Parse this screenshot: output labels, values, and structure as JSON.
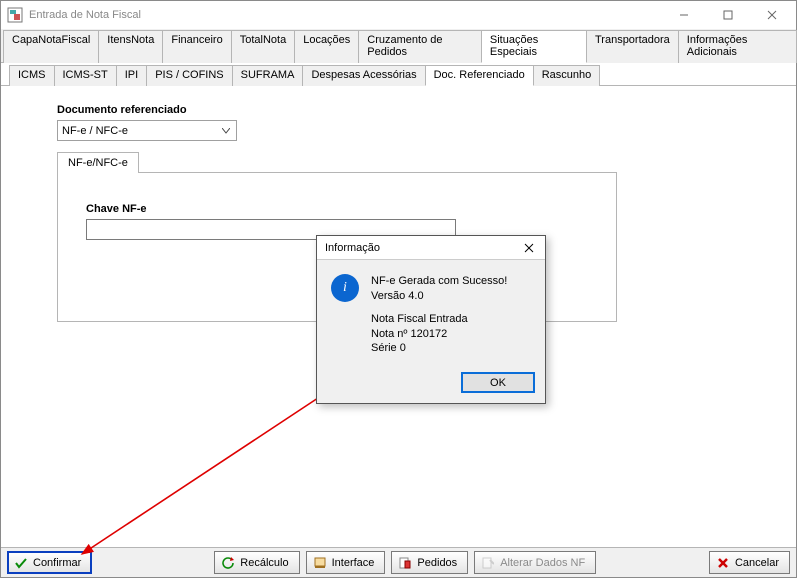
{
  "window": {
    "title": "Entrada de Nota Fiscal"
  },
  "tabs1": {
    "items": [
      "CapaNotaFiscal",
      "ItensNota",
      "Financeiro",
      "TotalNota",
      "Locações",
      "Cruzamento de Pedidos",
      "Situações Especiais",
      "Transportadora",
      "Informações Adicionais"
    ],
    "activeIndex": 6
  },
  "tabs2": {
    "items": [
      "ICMS",
      "ICMS-ST",
      "IPI",
      "PIS / COFINS",
      "SUFRAMA",
      "Despesas Acessórias",
      "Doc. Referenciado",
      "Rascunho"
    ],
    "activeIndex": 6
  },
  "form": {
    "docref_label": "Documento referenciado",
    "docref_value": "NF-e / NFC-e",
    "inner_tab": "NF-e/NFC-e",
    "chave_label": "Chave NF-e",
    "chave_value": ""
  },
  "dialog": {
    "title": "Informação",
    "line1": "NF-e Gerada com Sucesso!",
    "line2": "Versão 4.0",
    "line3": "Nota Fiscal Entrada",
    "line4": "Nota  nº 120172",
    "line5": "Série 0",
    "ok": "OK"
  },
  "bottom": {
    "confirmar": "Confirmar",
    "recalculo": "Recálculo",
    "interface": "Interface",
    "pedidos": "Pedidos",
    "alterar": "Alterar Dados NF",
    "cancelar": "Cancelar"
  },
  "colors": {
    "accent": "#0a3fbf",
    "infoBlue": "#0b66d0",
    "arrow": "#de0000"
  }
}
